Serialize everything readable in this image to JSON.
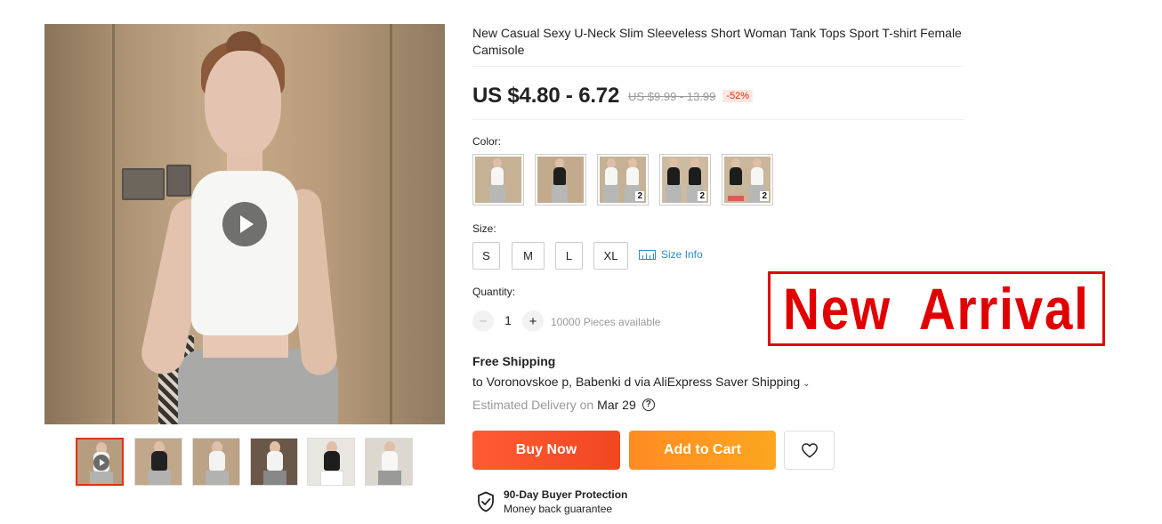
{
  "product": {
    "title": "New Casual Sexy U-Neck Slim Sleeveless Short Woman Tank Tops Sport T-shirt Female Camisole",
    "price": "US $4.80 - 6.72",
    "original_price": "US $9.99 - 13.99",
    "discount": "-52%"
  },
  "gallery": {
    "main_has_video": true,
    "thumbnails": [
      {
        "variant": "white",
        "video": true,
        "active": true
      },
      {
        "variant": "black",
        "video": false,
        "active": false
      },
      {
        "variant": "white",
        "video": false,
        "active": false
      },
      {
        "variant": "white",
        "video": false,
        "active": false
      },
      {
        "variant": "black",
        "video": false,
        "active": false
      },
      {
        "variant": "white",
        "video": false,
        "active": false
      }
    ]
  },
  "color": {
    "label": "Color:",
    "swatches": [
      {
        "variant": "white",
        "badge": ""
      },
      {
        "variant": "black",
        "badge": ""
      },
      {
        "variant": "white-pair",
        "badge": "2"
      },
      {
        "variant": "black-pair",
        "badge": "2"
      },
      {
        "variant": "black-white",
        "badge": "2"
      }
    ]
  },
  "size": {
    "label": "Size:",
    "options": [
      "S",
      "M",
      "L",
      "XL"
    ],
    "info_label": "Size Info"
  },
  "quantity": {
    "label": "Quantity:",
    "minus": "−",
    "plus": "+",
    "value": "1",
    "available": "10000 Pieces available"
  },
  "shipping": {
    "title": "Free Shipping",
    "destination": "to Voronovskoe p, Babenki d via AliExpress Saver Shipping",
    "estimated_label": "Estimated Delivery on",
    "estimated_date": "Mar 29",
    "help_glyph": "?"
  },
  "actions": {
    "buy_now": "Buy Now",
    "add_to_cart": "Add to Cart"
  },
  "protection": {
    "title": "90-Day Buyer Protection",
    "subtitle": "Money back guarantee"
  },
  "banner": {
    "text": "New Arrival"
  },
  "colors": {
    "accent_red": "#e62e04",
    "buy_now": "#f0471f",
    "add_to_cart": "#fca61e",
    "link_blue": "#2e8bc8",
    "banner_red": "#e10000"
  },
  "icons": [
    "play-icon",
    "ruler-icon",
    "chevron-down-icon",
    "help-icon",
    "heart-icon",
    "shield-check-icon"
  ]
}
